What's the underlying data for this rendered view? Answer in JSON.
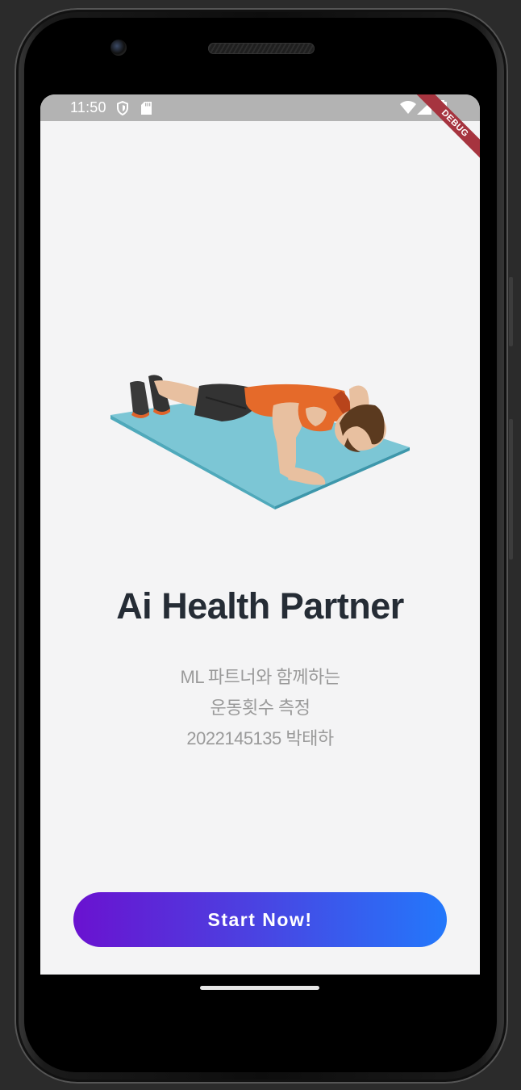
{
  "status_bar": {
    "time": "11:50",
    "icons": [
      "shield-icon",
      "sd-card-icon",
      "wifi-icon",
      "signal-icon",
      "battery-icon"
    ]
  },
  "debug_banner": "DEBUG",
  "hero_image": "push-up-illustration",
  "title": "Ai Health Partner",
  "subtitle_lines": [
    "ML 파트너와 함께하는",
    "운동횟수 측정",
    "2022145135 박태하"
  ],
  "start_button": {
    "label": "Start Now!",
    "gradient": [
      "#6a12d0",
      "#2378fb"
    ]
  },
  "colors": {
    "background": "#f4f4f5",
    "title": "#252c35",
    "subtitle": "#9a9a9a",
    "status_bar": "#b3b3b3"
  }
}
